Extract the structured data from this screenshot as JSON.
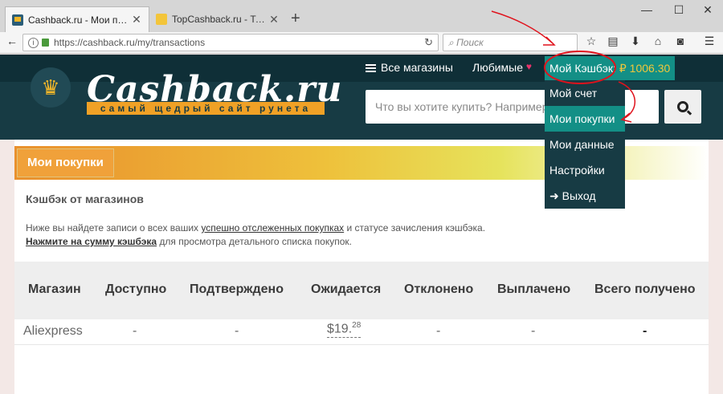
{
  "browser": {
    "tabs": [
      {
        "title": "Cashback.ru - Мои покупки",
        "active": true
      },
      {
        "title": "TopCashback.ru - Топ лучш",
        "active": false
      }
    ],
    "new_tab": "+",
    "window_controls": {
      "minimize": "—",
      "maximize": "☐",
      "close": "✕"
    },
    "url": "https://cashback.ru/my/transactions",
    "search_placeholder": "Поиск"
  },
  "site": {
    "logo": "Cashback.ru",
    "tagline": "самый щедрый сайт рунета",
    "nav": {
      "all_stores": "Все магазины",
      "favorites": "Любимые",
      "my_cashback": "Мой Кэшбэк:",
      "balance": "₽ 1006.30"
    },
    "search_placeholder": "Что вы хотите купить? Например",
    "dropdown": [
      {
        "label": "Мой счет",
        "active": false
      },
      {
        "label": "Мои покупки",
        "active": true
      },
      {
        "label": "Мои данные",
        "active": false
      },
      {
        "label": "Настройки",
        "active": false
      },
      {
        "label": "Выход",
        "active": false
      }
    ]
  },
  "page": {
    "title": "Мои покупки",
    "section_title": "Кэшбэк от магазинов",
    "desc_prefix": "Ниже вы найдете записи о всех ваших ",
    "desc_link": "успешно отслеженных покупках",
    "desc_suffix": " и статусе зачисления кэшбэка.",
    "desc2_link": "Нажмите на сумму кэшбэка",
    "desc2_suffix": " для просмотра детального списка покупок."
  },
  "table": {
    "headers": [
      "Магазин",
      "Доступно",
      "Подтверждено",
      "Ожидается",
      "Отклонено",
      "Выплачено",
      "Всего получено"
    ],
    "rows": [
      {
        "store": "Aliexpress",
        "available": "-",
        "confirmed": "-",
        "pending_main": "$19.",
        "pending_cents": "28",
        "rejected": "-",
        "paid": "-",
        "total": "-"
      }
    ]
  },
  "colors": {
    "header_bg": "#173b44",
    "accent_teal": "#138f86",
    "brand_orange": "#f0a126",
    "annotation_red": "#e0121c"
  }
}
